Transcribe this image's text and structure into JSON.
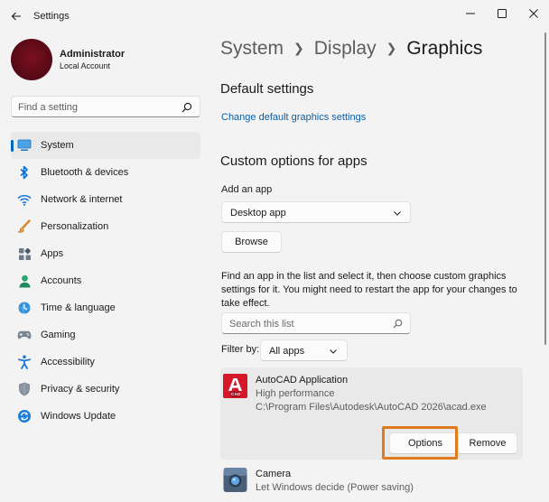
{
  "window": {
    "title": "Settings"
  },
  "profile": {
    "name": "Administrator",
    "account_type": "Local Account"
  },
  "sidebar": {
    "search_placeholder": "Find a setting",
    "items": [
      {
        "label": "System",
        "icon": "monitor-icon",
        "active": true
      },
      {
        "label": "Bluetooth & devices",
        "icon": "bluetooth-icon"
      },
      {
        "label": "Network & internet",
        "icon": "wifi-icon"
      },
      {
        "label": "Personalization",
        "icon": "paintbrush-icon"
      },
      {
        "label": "Apps",
        "icon": "apps-icon"
      },
      {
        "label": "Accounts",
        "icon": "person-icon"
      },
      {
        "label": "Time & language",
        "icon": "clock-globe-icon"
      },
      {
        "label": "Gaming",
        "icon": "gamepad-icon"
      },
      {
        "label": "Accessibility",
        "icon": "accessibility-icon"
      },
      {
        "label": "Privacy & security",
        "icon": "shield-icon"
      },
      {
        "label": "Windows Update",
        "icon": "update-icon"
      }
    ]
  },
  "breadcrumb": {
    "items": [
      "System",
      "Display"
    ],
    "current": "Graphics"
  },
  "main": {
    "default_settings_title": "Default settings",
    "change_default_link": "Change default graphics settings",
    "custom_options_title": "Custom options for apps",
    "add_app_label": "Add an app",
    "app_type_selected": "Desktop app",
    "browse_label": "Browse",
    "instructions": "Find an app in the list and select it, then choose custom graphics settings for it. You might need to restart the app for your changes to take effect.",
    "list_search_placeholder": "Search this list",
    "filter_label": "Filter by:",
    "filter_selected": "All apps"
  },
  "apps": [
    {
      "name": "AutoCAD Application",
      "preference": "High performance",
      "path": "C:\\Program Files\\Autodesk\\AutoCAD 2026\\acad.exe",
      "icon_text": "CAD",
      "options_label": "Options",
      "remove_label": "Remove"
    },
    {
      "name": "Camera",
      "preference": "Let Windows decide (Power saving)"
    }
  ],
  "colors": {
    "accent": "#0067c0",
    "highlight_box": "#e07a1f",
    "autocad_red": "#d6172a"
  }
}
